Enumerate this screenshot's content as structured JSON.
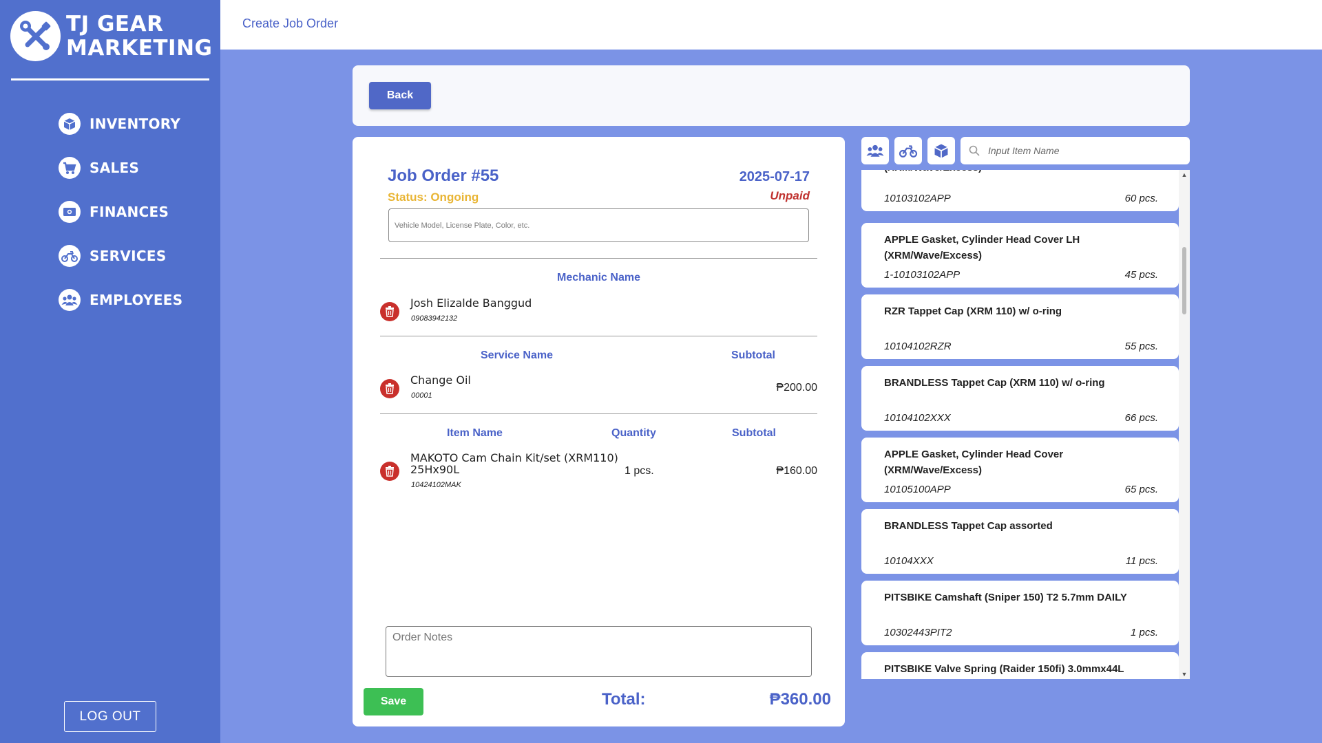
{
  "brand": {
    "line1": "TJ GEAR",
    "line2": "MARKETING"
  },
  "nav": [
    {
      "label": "INVENTORY",
      "icon": "box-icon"
    },
    {
      "label": "SALES",
      "icon": "cart-icon"
    },
    {
      "label": "FINANCES",
      "icon": "money-icon"
    },
    {
      "label": "SERVICES",
      "icon": "motorcycle-icon"
    },
    {
      "label": "EMPLOYEES",
      "icon": "users-icon"
    }
  ],
  "logout_label": "LOG OUT",
  "page_title": "Create Job Order",
  "back_label": "Back",
  "order": {
    "title": "Job Order #55",
    "date": "2025-07-17",
    "status": "Status: Ongoing",
    "payment_status": "Unpaid",
    "vehicle_placeholder": "Vehicle Model, License Plate, Color, etc.",
    "mechanic_header": "Mechanic Name",
    "mechanic": {
      "name": "Josh Elizalde Banggud",
      "phone": "09083942132"
    },
    "service_headers": {
      "name": "Service Name",
      "subtotal": "Subtotal"
    },
    "services": [
      {
        "name": "Change Oil",
        "code": "00001",
        "subtotal": "₱200.00"
      }
    ],
    "item_headers": {
      "name": "Item Name",
      "quantity": "Quantity",
      "subtotal": "Subtotal"
    },
    "items": [
      {
        "name_line1": "MAKOTO Cam Chain Kit/set (XRM110)",
        "name_line2": "25Hx90L",
        "code": "10424102MAK",
        "quantity": "1 pcs.",
        "subtotal": "₱160.00"
      }
    ],
    "notes_placeholder": "Order Notes",
    "save_label": "Save",
    "total_label": "Total:",
    "total_value": "₱360.00"
  },
  "search_placeholder": "Input Item Name",
  "filter_icons": [
    "users-icon",
    "motorcycle-icon",
    "box-icon"
  ],
  "item_cards": [
    {
      "name": "(XRM/Wave/Excess)",
      "code": "10103102APP",
      "qty": "60 pcs."
    },
    {
      "name": "APPLE Gasket, Cylinder Head Cover LH (XRM/Wave/Excess)",
      "code": "1-10103102APP",
      "qty": "45 pcs."
    },
    {
      "name": "RZR Tappet Cap (XRM 110) w/ o-ring",
      "code": "10104102RZR",
      "qty": "55 pcs."
    },
    {
      "name": "BRANDLESS Tappet Cap (XRM 110) w/ o-ring",
      "code": "10104102XXX",
      "qty": "66 pcs."
    },
    {
      "name": "APPLE Gasket, Cylinder Head Cover (XRM/Wave/Excess)",
      "code": "10105100APP",
      "qty": "65 pcs."
    },
    {
      "name": "BRANDLESS Tappet Cap assorted",
      "code": "10104XXX",
      "qty": "11 pcs."
    },
    {
      "name": "PITSBIKE Camshaft (Sniper 150) T2 5.7mm DAILY",
      "code": "10302443PIT2",
      "qty": "1 pcs."
    },
    {
      "name": "PITSBIKE Valve Spring (Raider 150fi) 3.0mmx44L",
      "code": "",
      "qty": ""
    }
  ],
  "colors": {
    "sidebar": "#5170cd",
    "background": "#7b93e6",
    "accent": "#4a62c8",
    "status": "#e9b534",
    "unpaid": "#c0322f",
    "save": "#3dbf54",
    "delete": "#c9302c"
  }
}
